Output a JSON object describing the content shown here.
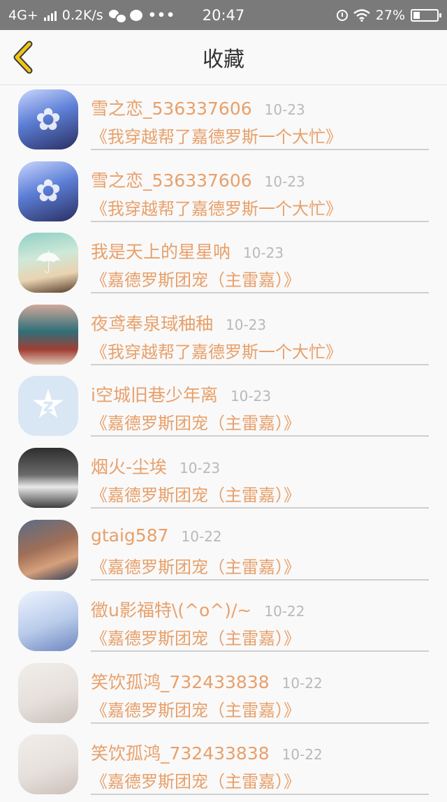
{
  "status_bar": {
    "network": "4G+",
    "speed": "0.2K/s",
    "dots": "•••",
    "time": "20:47",
    "battery": "27%",
    "battery_level": 0.27
  },
  "header": {
    "title": "收藏"
  },
  "items": [
    {
      "name": "雪之恋_536337606",
      "date": "10-23",
      "book": "《我穿越帮了嘉德罗斯一个大忙》"
    },
    {
      "name": "雪之恋_536337606",
      "date": "10-23",
      "book": "《我穿越帮了嘉德罗斯一个大忙》"
    },
    {
      "name": "我是天上的星星呐",
      "date": "10-23",
      "book": "《嘉德罗斯团宠（主雷嘉）》"
    },
    {
      "name": "夜鸢奉泉琙秞秞",
      "date": "10-23",
      "book": "《我穿越帮了嘉德罗斯一个大忙》"
    },
    {
      "name": "i空城旧巷少年离",
      "date": "10-23",
      "book": "《嘉德罗斯团宠（主雷嘉）》"
    },
    {
      "name": "烟火-尘埃",
      "date": "10-23",
      "book": "《嘉德罗斯团宠（主雷嘉）》"
    },
    {
      "name": "gtaig587",
      "date": "10-22",
      "book": "《嘉德罗斯团宠（主雷嘉）》"
    },
    {
      "name": "徾u影福特\\(^o^)/~",
      "date": "10-22",
      "book": "《嘉德罗斯团宠（主雷嘉）》"
    },
    {
      "name": "笑饮孤鸿_732433838",
      "date": "10-22",
      "book": "《嘉德罗斯团宠（主雷嘉）》"
    },
    {
      "name": "笑饮孤鸿_732433838",
      "date": "10-22",
      "book": "《嘉德罗斯团宠（主雷嘉）》"
    }
  ],
  "colors": {
    "accent": "#e8a06a",
    "date": "#b9b9b9",
    "status_bar": "#7a7a7a",
    "back_icon": "#f0c419"
  }
}
